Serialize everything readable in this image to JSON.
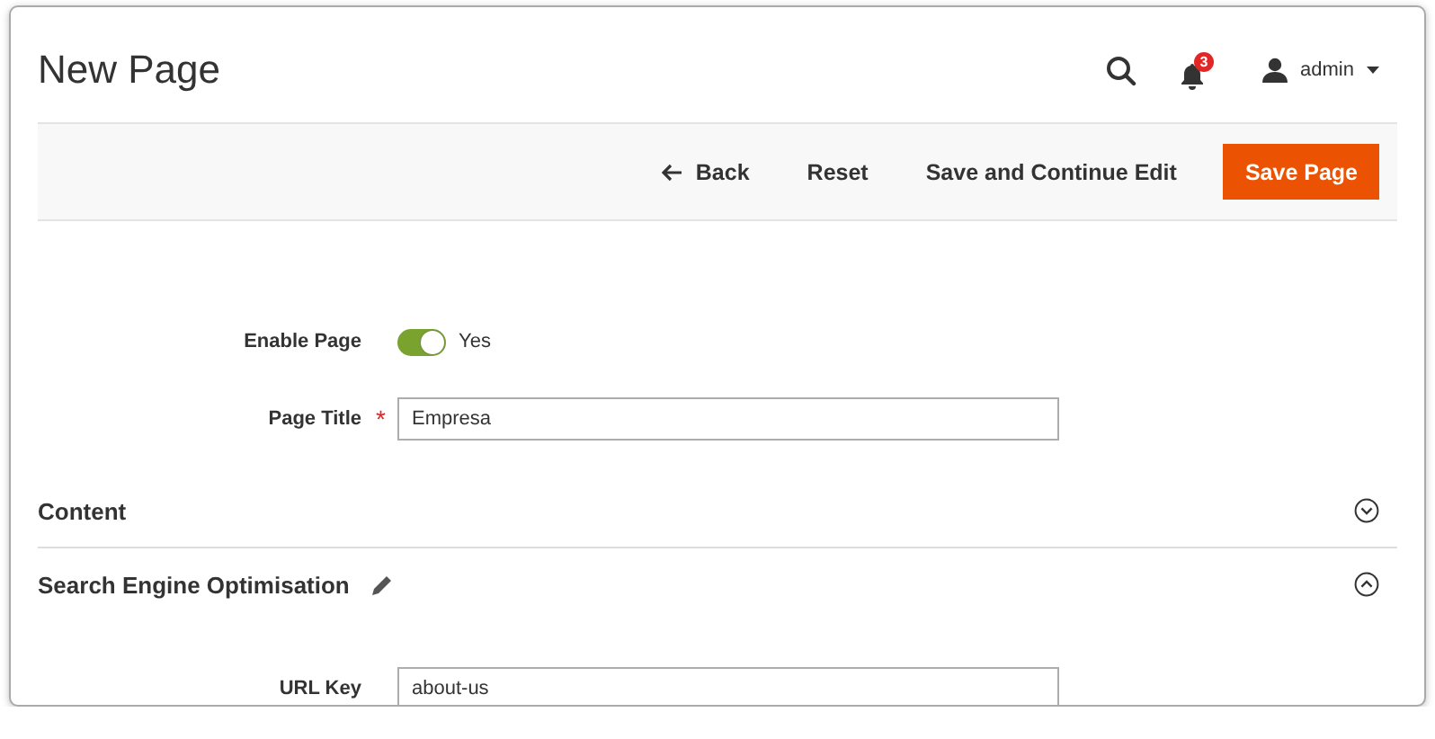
{
  "header": {
    "title": "New Page",
    "notifications": {
      "count": "3"
    },
    "user": {
      "name": "admin"
    }
  },
  "actions": [
    {
      "label": "Back",
      "kind": "back"
    },
    {
      "label": "Reset",
      "kind": "link"
    },
    {
      "label": "Save and Continue Edit",
      "kind": "link"
    },
    {
      "label": "Save Page",
      "kind": "primary"
    }
  ],
  "fields": [
    {
      "kind": "toggle",
      "label": "Enable Page",
      "on": true,
      "value": "Yes"
    },
    {
      "kind": "text",
      "label": "Page Title",
      "required_mark": "*",
      "value": "Empresa"
    }
  ],
  "sections": [
    {
      "title": "Content",
      "expanded": false,
      "editable": false
    },
    {
      "title": "Search Engine Optimisation",
      "expanded": true,
      "editable": true,
      "fields": [
        {
          "kind": "text",
          "label": "URL Key",
          "value": "about-us"
        }
      ]
    }
  ]
}
